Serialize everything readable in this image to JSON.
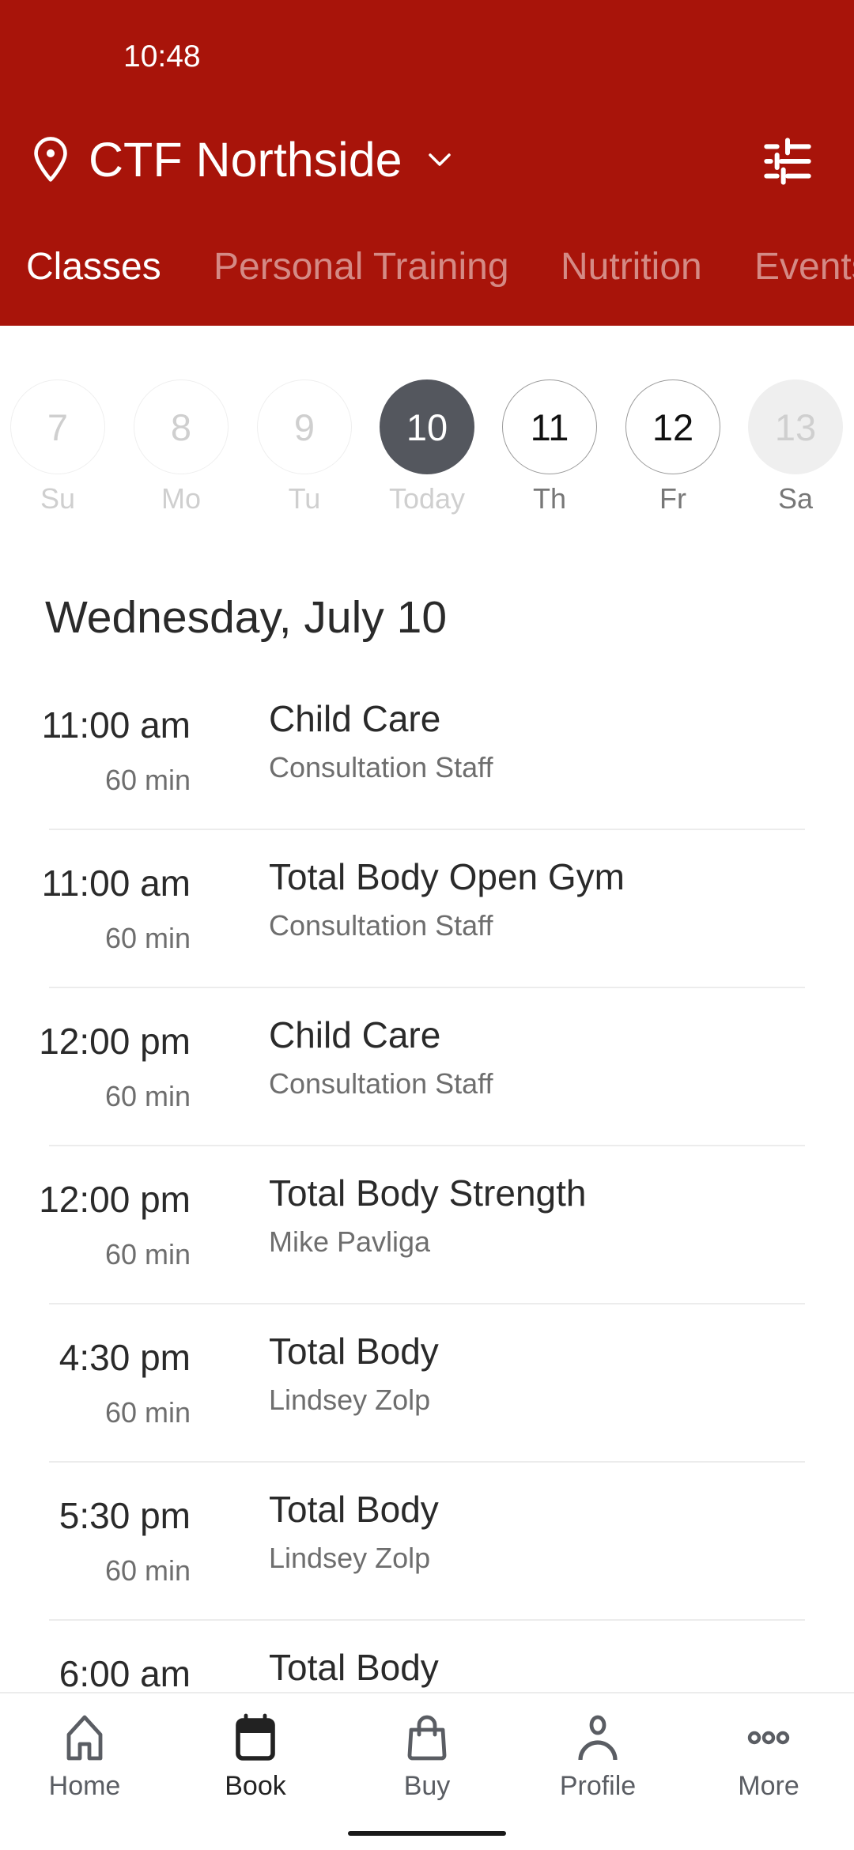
{
  "status_bar": {
    "time": "10:48"
  },
  "header": {
    "location_name": "CTF Northside",
    "location_icon": "map-pin-icon",
    "dropdown_icon": "chevron-down-icon",
    "filter_icon": "sliders-filter-icon",
    "brand_color": "#a8140a"
  },
  "tabs": [
    {
      "label": "Classes",
      "active": true
    },
    {
      "label": "Personal Training",
      "active": false
    },
    {
      "label": "Nutrition",
      "active": false
    },
    {
      "label": "Events",
      "active": false
    }
  ],
  "week_days": [
    {
      "number": "7",
      "label": "Su",
      "state": "past"
    },
    {
      "number": "8",
      "label": "Mo",
      "state": "past"
    },
    {
      "number": "9",
      "label": "Tu",
      "state": "past"
    },
    {
      "number": "10",
      "label": "Today",
      "state": "selected"
    },
    {
      "number": "11",
      "label": "Th",
      "state": "available"
    },
    {
      "number": "12",
      "label": "Fr",
      "state": "available"
    },
    {
      "number": "13",
      "label": "Sa",
      "state": "unavailable"
    }
  ],
  "selected_date_heading": "Wednesday, July 10",
  "classes": [
    {
      "time": "11:00 am",
      "duration": "60 min",
      "name": "Child Care",
      "instructor": "Consultation Staff"
    },
    {
      "time": "11:00 am",
      "duration": "60 min",
      "name": "Total Body Open Gym",
      "instructor": "Consultation Staff"
    },
    {
      "time": "12:00 pm",
      "duration": "60 min",
      "name": "Child Care",
      "instructor": "Consultation Staff"
    },
    {
      "time": "12:00 pm",
      "duration": "60 min",
      "name": "Total Body Strength",
      "instructor": "Mike Pavliga"
    },
    {
      "time": "4:30 pm",
      "duration": "60 min",
      "name": "Total Body",
      "instructor": "Lindsey Zolp"
    },
    {
      "time": "5:30 pm",
      "duration": "60 min",
      "name": "Total Body",
      "instructor": "Lindsey Zolp"
    },
    {
      "time": "6:00 am",
      "duration": "",
      "name": "Total Body",
      "instructor": ""
    }
  ],
  "bottom_nav": [
    {
      "label": "Home",
      "icon": "home-icon",
      "active": false
    },
    {
      "label": "Book",
      "icon": "calendar-icon",
      "active": true
    },
    {
      "label": "Buy",
      "icon": "shopping-bag-icon",
      "active": false
    },
    {
      "label": "Profile",
      "icon": "person-icon",
      "active": false
    },
    {
      "label": "More",
      "icon": "more-dots-icon",
      "active": false
    }
  ]
}
